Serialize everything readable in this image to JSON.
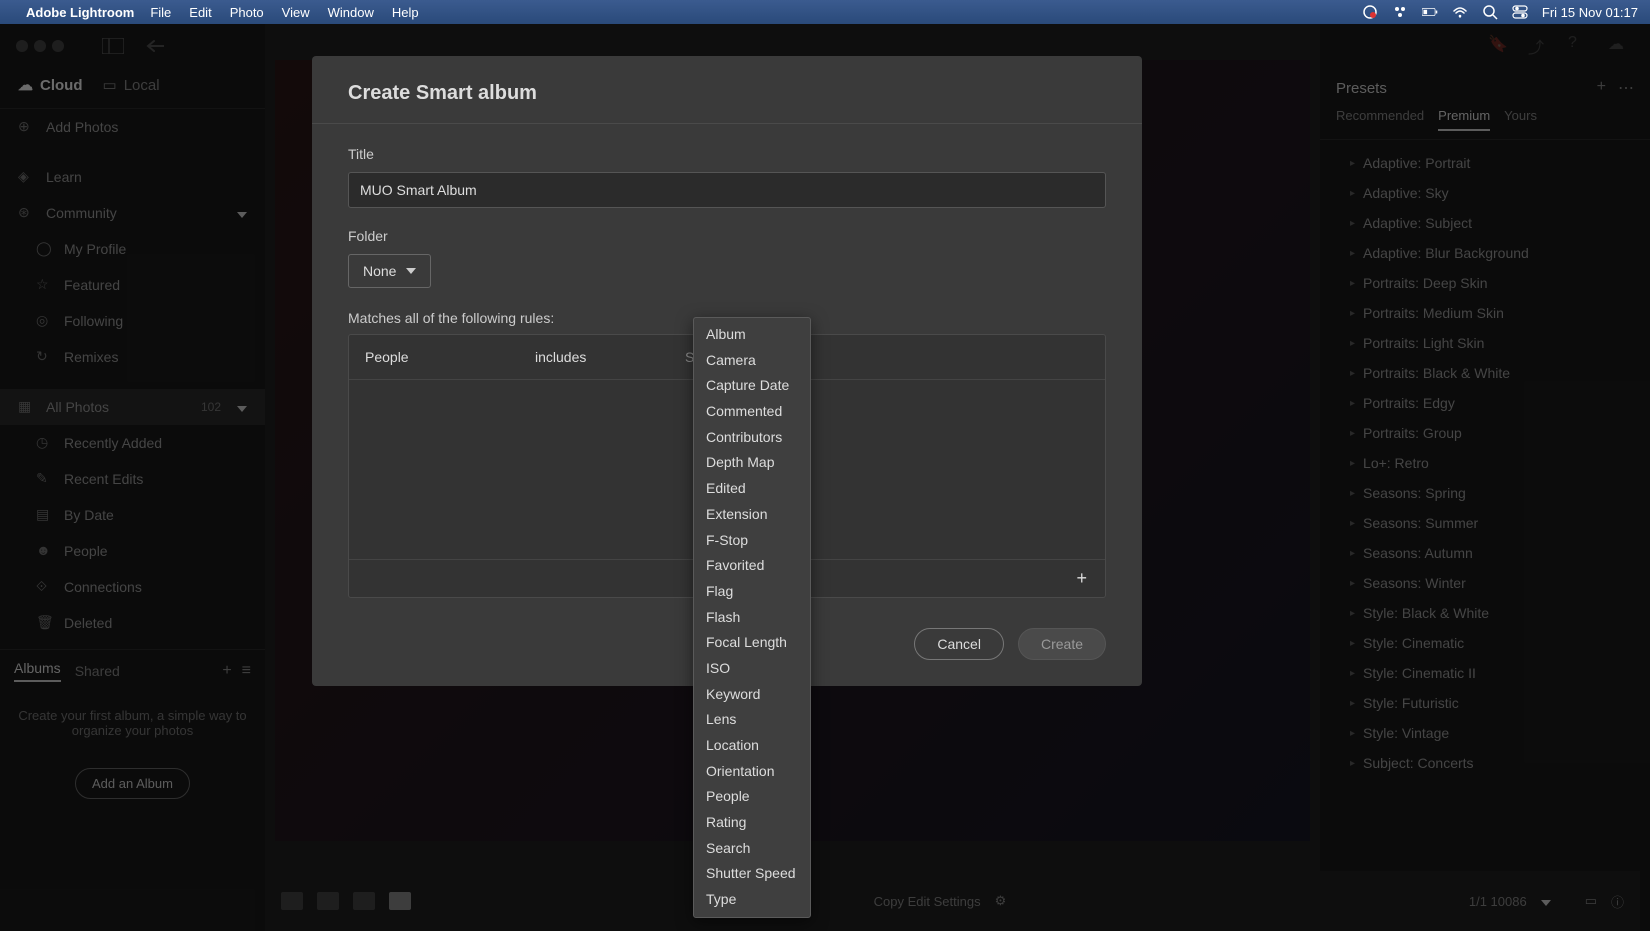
{
  "menubar": {
    "app": "Adobe Lightroom",
    "items": [
      "File",
      "Edit",
      "Photo",
      "View",
      "Window",
      "Help"
    ],
    "clock": "Fri 15 Nov  01:17"
  },
  "sidebar": {
    "source_tabs": {
      "cloud": "Cloud",
      "local": "Local"
    },
    "add_photos": "Add Photos",
    "learn": "Learn",
    "community": "Community",
    "community_items": [
      "My Profile",
      "Featured",
      "Following",
      "Remixes"
    ],
    "all_photos": {
      "label": "All Photos",
      "count": "102"
    },
    "filters": [
      "Recently Added",
      "Recent Edits",
      "By Date",
      "People",
      "Connections",
      "Deleted"
    ],
    "albums_tabs": {
      "albums": "Albums",
      "shared": "Shared"
    },
    "albums_empty": "Create your first album, a simple way to organize your photos",
    "add_album_btn": "Add an Album"
  },
  "rightpanel": {
    "header": "Presets",
    "tabs": {
      "recommended": "Recommended",
      "premium": "Premium",
      "yours": "Yours"
    },
    "presets": [
      "Adaptive: Portrait",
      "Adaptive: Sky",
      "Adaptive: Subject",
      "Adaptive: Blur Background",
      "Portraits: Deep Skin",
      "Portraits: Medium Skin",
      "Portraits: Light Skin",
      "Portraits: Black & White",
      "Portraits: Edgy",
      "Portraits: Group",
      "Lo+: Retro",
      "Seasons: Spring",
      "Seasons: Summer",
      "Seasons: Autumn",
      "Seasons: Winter",
      "Style: Black & White",
      "Style: Cinematic",
      "Style: Cinematic II",
      "Style: Futuristic",
      "Style: Vintage",
      "Subject: Concerts"
    ]
  },
  "bottombar": {
    "filename": "1/1  10086",
    "copy_label": "Copy Edit Settings"
  },
  "modal": {
    "title": "Create Smart album",
    "title_label": "Title",
    "title_value": "MUO Smart Album",
    "folder_label": "Folder",
    "folder_value": "None",
    "rules_label": "Matches all of the following rules:",
    "rule": {
      "field": "People",
      "op": "includes",
      "value": "Select"
    },
    "cancel": "Cancel",
    "create": "Create"
  },
  "dropdown": {
    "items": [
      "Album",
      "Camera",
      "Capture Date",
      "Commented",
      "Contributors",
      "Depth Map",
      "Edited",
      "Extension",
      "F-Stop",
      "Favorited",
      "Flag",
      "Flash",
      "Focal Length",
      "ISO",
      "Keyword",
      "Lens",
      "Location",
      "Orientation",
      "People",
      "Rating",
      "Search",
      "Shutter Speed",
      "Type"
    ]
  }
}
